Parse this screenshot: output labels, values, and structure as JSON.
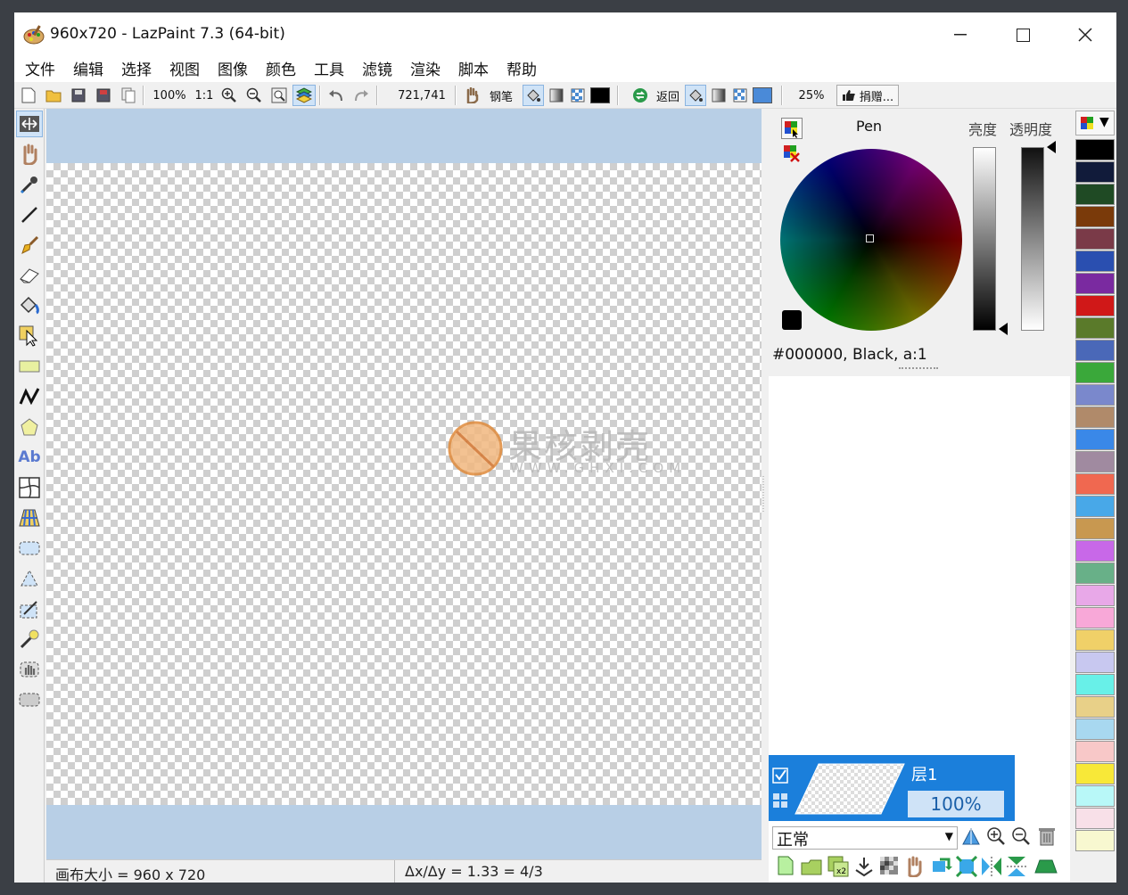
{
  "window": {
    "title": "960x720 - LazPaint 7.3 (64-bit)"
  },
  "menu": [
    "文件",
    "编辑",
    "选择",
    "视图",
    "图像",
    "颜色",
    "工具",
    "滤镜",
    "渲染",
    "脚本",
    "帮助"
  ],
  "toolbar": {
    "zoom_level": "100%",
    "zoom_actual": "1:1",
    "coordinates": "721,741",
    "pen_label": "钢笔",
    "back_label": "返回",
    "tolerance": "25%",
    "donate_label": "捐赠..."
  },
  "color_panel": {
    "pen_label": "Pen",
    "lightness_label": "亮度",
    "alpha_label": "透明度",
    "color_readout": "#000000, Black, a:1"
  },
  "layer": {
    "name": "层1",
    "opacity": "100%",
    "blend_mode": "正常"
  },
  "status": {
    "canvas_size": "画布大小 = 960 x 720",
    "ratio": "Δx/Δy = 1.33 = 4/3"
  },
  "watermark": {
    "text": "果核剥壳",
    "url": "WWW.GHXI.COM"
  },
  "palette": [
    "#000000",
    "#111b3a",
    "#1f4a24",
    "#7a3a0a",
    "#7a3a48",
    "#2a4fb0",
    "#7a2aa0",
    "#d01818",
    "#5a7a2a",
    "#4a68b8",
    "#3aa83a",
    "#7a88cc",
    "#b08a6a",
    "#3a88e8",
    "#a08aa0",
    "#f06850",
    "#48a8e8",
    "#c89850",
    "#c868e8",
    "#68b088",
    "#e8a8e8",
    "#f8a8d8",
    "#f0d068",
    "#c8c8f0",
    "#68f0e8",
    "#e8d088",
    "#a8d8f0",
    "#f8c8c8",
    "#f8e838",
    "#b8f8f8",
    "#f8e0e8",
    "#f8f8d0"
  ]
}
